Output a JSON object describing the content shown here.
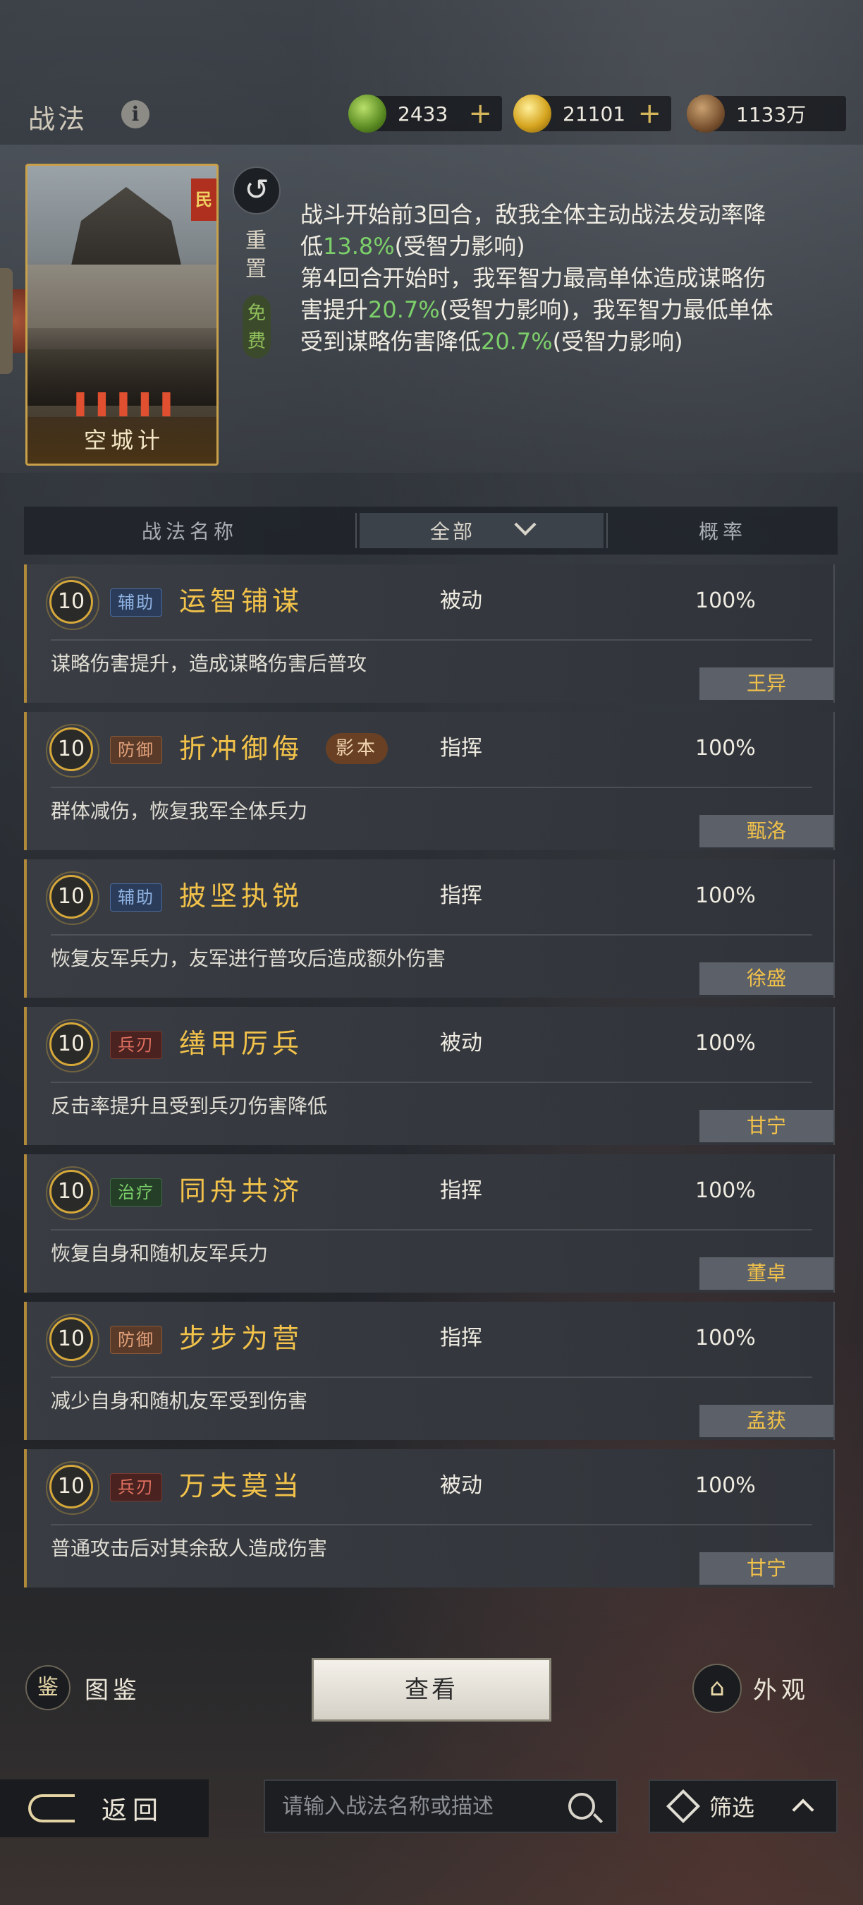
{
  "header": {
    "title": "战法",
    "resources": [
      {
        "icon": "jade-coin-icon",
        "value": "2433",
        "has_plus": true
      },
      {
        "icon": "gold-coin-icon",
        "value": "21101",
        "has_plus": true
      },
      {
        "icon": "copper-coin-icon",
        "value": "1133万",
        "has_plus": false
      }
    ],
    "plus": "+"
  },
  "selected_skill": {
    "card_name": "空城计",
    "stars": "❚❚❚❚❚",
    "card_flag": "民",
    "reset_label": "重置",
    "free_label": "免费",
    "desc_parts": [
      {
        "t": "战斗开始前3回合，敌我全体主动战法发动率降低",
        "green": false
      },
      {
        "t": "13.8%",
        "green": true
      },
      {
        "t": "(受智力影响)",
        "green": false
      },
      {
        "t": "\n第4回合开始时，我军智力最高单体造成谋略伤害提升",
        "green": false
      },
      {
        "t": "20.7%",
        "green": true
      },
      {
        "t": "(受智力影响)，我军智力最低单体受到谋略伤害降低",
        "green": false
      },
      {
        "t": "20.7%",
        "green": true
      },
      {
        "t": "(受智力影响)",
        "green": false
      }
    ]
  },
  "table_header": {
    "name_col": "战法名称",
    "filter_value": "全部",
    "prob_col": "概率"
  },
  "skills": [
    {
      "level": "10",
      "tag": "辅助",
      "tag_type": "aux",
      "name": "运智铺谋",
      "shadow": "",
      "type": "被动",
      "prob": "100%",
      "desc": "谋略伤害提升，造成谋略伤害后普攻",
      "hero": "王异"
    },
    {
      "level": "10",
      "tag": "防御",
      "tag_type": "def",
      "name": "折冲御侮",
      "shadow": "影本",
      "type": "指挥",
      "prob": "100%",
      "desc": "群体减伤，恢复我军全体兵力",
      "hero": "甄洛"
    },
    {
      "level": "10",
      "tag": "辅助",
      "tag_type": "aux",
      "name": "披坚执锐",
      "shadow": "",
      "type": "指挥",
      "prob": "100%",
      "desc": "恢复友军兵力，友军进行普攻后造成额外伤害",
      "hero": "徐盛"
    },
    {
      "level": "10",
      "tag": "兵刃",
      "tag_type": "blade",
      "name": "缮甲厉兵",
      "shadow": "",
      "type": "被动",
      "prob": "100%",
      "desc": "反击率提升且受到兵刃伤害降低",
      "hero": "甘宁"
    },
    {
      "level": "10",
      "tag": "治疗",
      "tag_type": "heal",
      "name": "同舟共济",
      "shadow": "",
      "type": "指挥",
      "prob": "100%",
      "desc": "恢复自身和随机友军兵力",
      "hero": "董卓"
    },
    {
      "level": "10",
      "tag": "防御",
      "tag_type": "def",
      "name": "步步为营",
      "shadow": "",
      "type": "指挥",
      "prob": "100%",
      "desc": "减少自身和随机友军受到伤害",
      "hero": "孟获"
    },
    {
      "level": "10",
      "tag": "兵刃",
      "tag_type": "blade",
      "name": "万夫莫当",
      "shadow": "",
      "type": "被动",
      "prob": "100%",
      "desc": "普通攻击后对其余敌人造成伤害",
      "hero": "甘宁"
    }
  ],
  "bottom": {
    "gallery_label": "图鉴",
    "view_label": "查看",
    "appearance_label": "外观",
    "back_label": "返回",
    "search_placeholder": "请输入战法名称或描述",
    "filter_label": "筛选"
  },
  "colors": {
    "accent_gold": "#f2c24a",
    "percent_green": "#7ccf6a",
    "border_gold": "#c9a04a"
  }
}
